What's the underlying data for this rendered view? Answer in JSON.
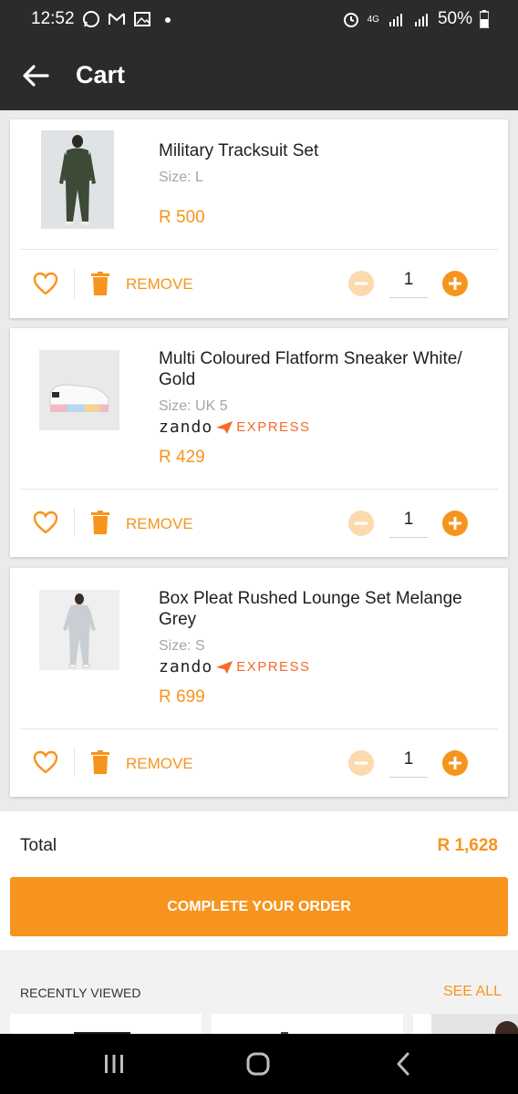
{
  "status_bar": {
    "time": "12:52",
    "network": "4G",
    "battery": "50%"
  },
  "header": {
    "title": "Cart"
  },
  "cart_items": [
    {
      "name": "Military Tracksuit Set",
      "size": "Size: L",
      "price": "R 500",
      "express": false,
      "quantity": "1",
      "remove_label": "REMOVE"
    },
    {
      "name": "Multi Coloured Flatform Sneaker White/ Gold",
      "size": "Size: UK 5",
      "price": "R 429",
      "express": true,
      "quantity": "1",
      "remove_label": "REMOVE"
    },
    {
      "name": "Box Pleat Rushed Lounge Set Melange Grey",
      "size": "Size: S",
      "price": "R 699",
      "express": true,
      "quantity": "1",
      "remove_label": "REMOVE"
    }
  ],
  "express_badge": {
    "brand": "zando",
    "label": "EXPRESS"
  },
  "summary": {
    "total_label": "Total",
    "total_value": "R 1,628",
    "order_button": "COMPLETE YOUR ORDER"
  },
  "recently_viewed": {
    "title": "RECENTLY VIEWED",
    "see_all": "SEE ALL"
  },
  "colors": {
    "accent": "#f7941d",
    "express": "#f26b2b",
    "app_bar": "#2b2b2b"
  }
}
